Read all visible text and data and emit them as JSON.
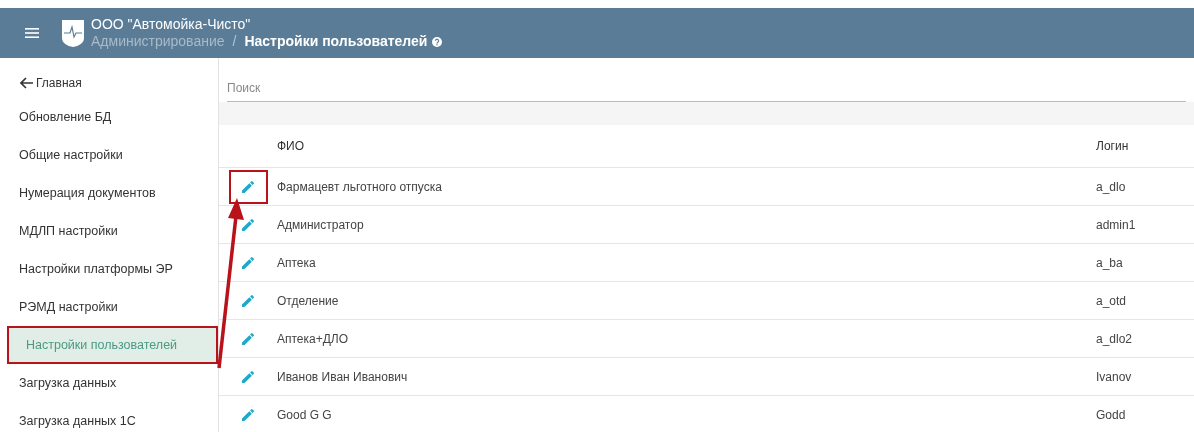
{
  "header": {
    "org": "ООО \"Автомойка-Чисто\"",
    "separator": "/",
    "breadcrumb": [
      {
        "label": "Администрирование",
        "current": false
      },
      {
        "label": "Настройки пользователей",
        "current": true
      }
    ]
  },
  "sidebar": {
    "back": "Главная",
    "items": [
      {
        "label": "Обновление БД",
        "selected": false,
        "annotated": false
      },
      {
        "label": "Общие настройки",
        "selected": false,
        "annotated": false
      },
      {
        "label": "Нумерация документов",
        "selected": false,
        "annotated": false
      },
      {
        "label": "МДЛП настройки",
        "selected": false,
        "annotated": false
      },
      {
        "label": "Настройки платформы ЭР",
        "selected": false,
        "annotated": false
      },
      {
        "label": "РЭМД настройки",
        "selected": false,
        "annotated": false
      },
      {
        "label": "Настройки пользователей",
        "selected": true,
        "annotated": true
      },
      {
        "label": "Загрузка данных",
        "selected": false,
        "annotated": false
      },
      {
        "label": "Загрузка данных 1С",
        "selected": false,
        "annotated": false
      }
    ]
  },
  "search": {
    "placeholder": "Поиск"
  },
  "table": {
    "columns": [
      "ФИО",
      "Логин"
    ],
    "rows": [
      {
        "name": "Фармацевт льготного отпуска",
        "login": "a_dlo",
        "annotated": true
      },
      {
        "name": "Администратор",
        "login": "admin1",
        "annotated": false
      },
      {
        "name": "Аптека",
        "login": "a_ba",
        "annotated": false
      },
      {
        "name": "Отделение",
        "login": "a_otd",
        "annotated": false
      },
      {
        "name": "Аптека+ДЛО",
        "login": "a_dlo2",
        "annotated": false
      },
      {
        "name": "Иванов Иван Иванович",
        "login": "Ivanov",
        "annotated": false
      },
      {
        "name": "Good G G",
        "login": "Godd",
        "annotated": false
      }
    ]
  }
}
